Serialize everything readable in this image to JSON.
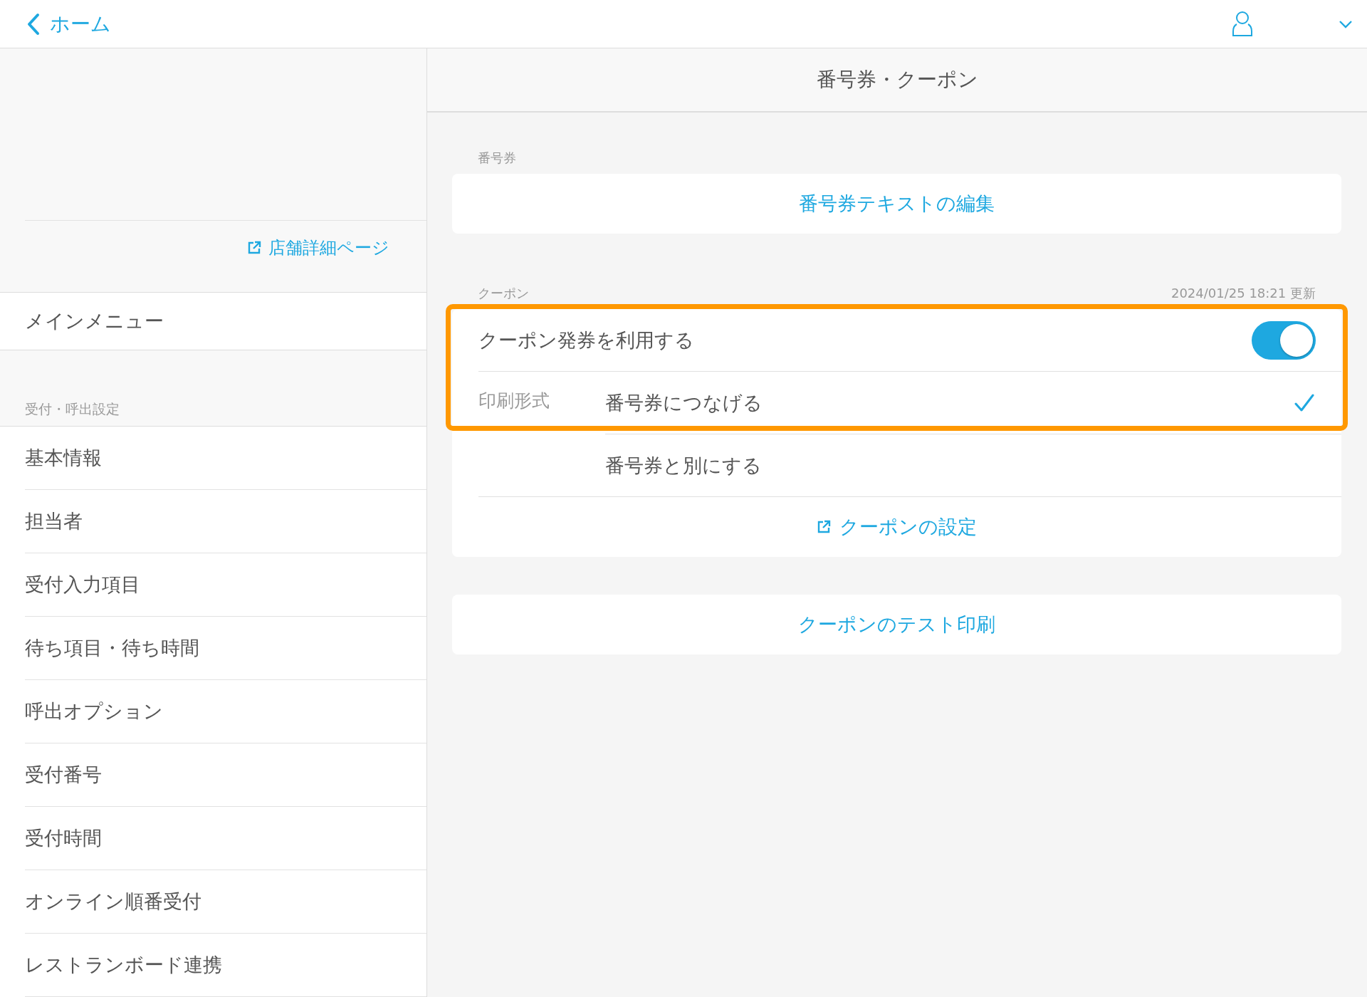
{
  "top_bar": {
    "back_label": "ホーム"
  },
  "sidebar": {
    "store_link": "店舗詳細ページ",
    "main_menu": "メインメニュー",
    "section_label": "受付・呼出設定",
    "items": [
      {
        "label": "基本情報"
      },
      {
        "label": "担当者"
      },
      {
        "label": "受付入力項目"
      },
      {
        "label": "待ち項目・待ち時間"
      },
      {
        "label": "呼出オプション"
      },
      {
        "label": "受付番号"
      },
      {
        "label": "受付時間"
      },
      {
        "label": "オンライン順番受付"
      },
      {
        "label": "レストランボード連携"
      }
    ]
  },
  "page": {
    "title": "番号券・クーポン",
    "ticket_section": {
      "label": "番号券",
      "button": "番号券テキストの編集"
    },
    "coupon_section": {
      "label": "クーポン",
      "updated": "2024/01/25 18:21 更新",
      "highlighted": true,
      "toggle": {
        "label": "クーポン発券を利用する",
        "on": true
      },
      "print_format": {
        "label": "印刷形式",
        "options": [
          {
            "label": "番号券につなげる",
            "selected": true
          },
          {
            "label": "番号券と別にする",
            "selected": false
          }
        ]
      },
      "settings_link": "クーポンの設定"
    },
    "test_print_button": "クーポンのテスト印刷"
  }
}
